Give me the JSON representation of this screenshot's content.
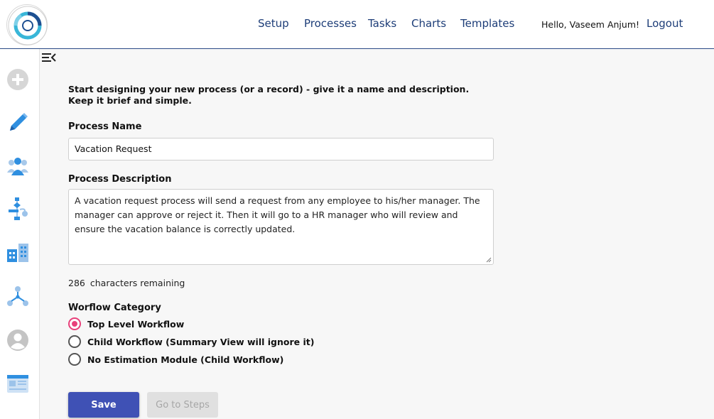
{
  "header": {
    "logo_icon": "my-biz-workflow-logo",
    "nav": [
      "Setup",
      "Processes",
      "Tasks",
      "Charts",
      "Templates"
    ],
    "greeting": "Hello,",
    "user_name": "Vaseem Anjum!",
    "logout": "Logout"
  },
  "sidebar": {
    "icons": [
      "add-icon",
      "edit-pencil-icon",
      "users-group-icon",
      "process-flow-icon",
      "buildings-icon",
      "network-icon",
      "user-profile-icon",
      "template-layout-icon"
    ]
  },
  "form": {
    "collapse_icon": "collapse-menu-icon",
    "intro": "Start designing your new process (or a record) - give it a name and description. Keep it brief and simple.",
    "name_label": "Process Name",
    "name_value": "Vacation Request",
    "description_label": "Process Description",
    "description_value": "A vacation request process will send a request from any employee to his/her manager. The manager can approve or reject it. Then it will go to a HR manager who will review and ensure the vacation balance is correctly updated.",
    "chars_remaining_count": "286",
    "chars_remaining_text": "characters remaining",
    "category_label": "Worflow Category",
    "categories": [
      {
        "label": "Top Level Workflow",
        "selected": true
      },
      {
        "label": "Child Workflow (Summary View will ignore it)",
        "selected": false
      },
      {
        "label": "No Estimation Module (Child Workflow)",
        "selected": false
      }
    ],
    "save_label": "Save",
    "steps_label": "Go to Steps"
  },
  "colors": {
    "nav_text": "#1d3d78",
    "primary_button": "#3f51b5",
    "radio_selected": "#e8407a",
    "header_border": "#2a4a86",
    "icon_blue": "#2f8fe0"
  }
}
